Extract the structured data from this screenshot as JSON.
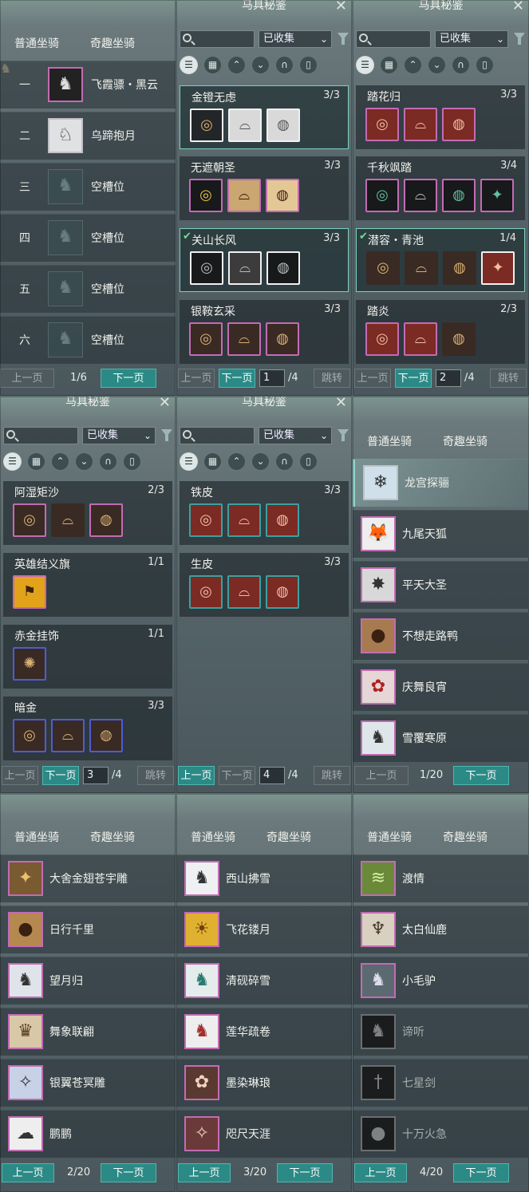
{
  "common": {
    "tab_normal": "普通坐骑",
    "tab_fun": "奇趣坐骑",
    "prev": "上一页",
    "next": "下一页",
    "jump": "跳转",
    "title": "马具秘鉴",
    "filter": "已收集",
    "close": "✕",
    "cats": [
      "☰",
      "▦",
      "⌃",
      "⌄",
      "∩",
      "▯"
    ]
  },
  "p1": {
    "slots": [
      {
        "num": "一",
        "name": "飞霞骠・黑云",
        "icon": "horse-icon"
      },
      {
        "num": "二",
        "name": "乌蹄抱月",
        "icon": "horse-icon"
      },
      {
        "num": "三",
        "name": "空槽位",
        "icon": "empty-icon"
      },
      {
        "num": "四",
        "name": "空槽位",
        "icon": "empty-icon"
      },
      {
        "num": "五",
        "name": "空槽位",
        "icon": "empty-icon"
      },
      {
        "num": "六",
        "name": "空槽位",
        "icon": "empty-icon"
      }
    ],
    "page": "1/6"
  },
  "p2": {
    "sets": [
      {
        "name": "金镫无虑",
        "count": "3/3"
      },
      {
        "name": "无遮朝圣",
        "count": "3/3"
      },
      {
        "name": "关山长风",
        "count": "3/3"
      },
      {
        "name": "银鞍玄采",
        "count": "3/3"
      }
    ],
    "page": "1",
    "total": "/4"
  },
  "p3": {
    "sets": [
      {
        "name": "踏花归",
        "count": "3/3"
      },
      {
        "name": "千秋飒踏",
        "count": "3/4"
      },
      {
        "name": "潜容・青池",
        "count": "1/4"
      },
      {
        "name": "踏炎",
        "count": "2/3"
      }
    ],
    "page": "2",
    "total": "/4"
  },
  "p4": {
    "sets": [
      {
        "name": "阿湿矩沙",
        "count": "2/3"
      },
      {
        "name": "英雄结义旗",
        "count": "1/1"
      },
      {
        "name": "赤金挂饰",
        "count": "1/1"
      },
      {
        "name": "暗金",
        "count": "3/3"
      }
    ],
    "page": "3",
    "total": "/4"
  },
  "p5": {
    "sets": [
      {
        "name": "铁皮",
        "count": "3/3"
      },
      {
        "name": "生皮",
        "count": "3/3"
      }
    ],
    "page": "4",
    "total": "/4"
  },
  "p6": {
    "mounts": [
      "龙宫探骊",
      "九尾天狐",
      "平天大圣",
      "不想走路鸭",
      "庆舞良宵",
      "雪覆寒原"
    ],
    "page": "1/20"
  },
  "p7": {
    "mounts": [
      "大舍金翅苍宇雕",
      "日行千里",
      "望月归",
      "舞象联翩",
      "银翼苍冥雕",
      "鹏鹏"
    ],
    "page": "2/20"
  },
  "p8": {
    "mounts": [
      "西山拂雪",
      "飞花镂月",
      "清砚碎雪",
      "莲华疏卷",
      "墨染琳琅",
      "咫尺天涯"
    ],
    "page": "3/20"
  },
  "p9": {
    "mounts": [
      "渡情",
      "太白仙鹿",
      "小毛驴",
      "谛听",
      "七星剑",
      "十万火急"
    ],
    "page": "4/20"
  }
}
